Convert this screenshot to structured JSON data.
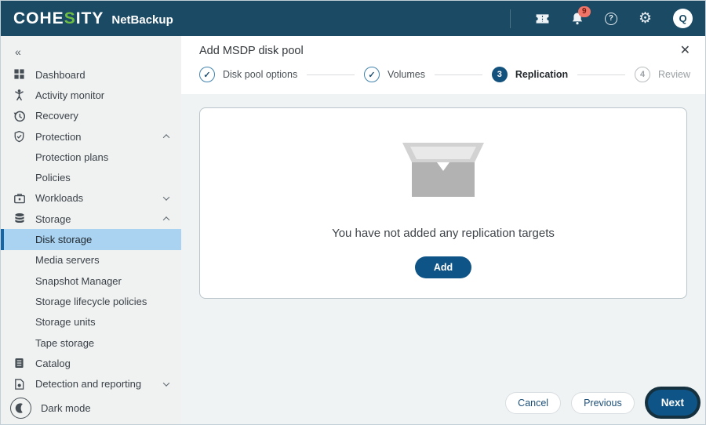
{
  "header": {
    "brand": {
      "part1": "COHE",
      "s": "S",
      "part2": "ITY",
      "product": "NetBackup"
    },
    "icons": [
      "ticket-icon",
      "bell-icon",
      "help-icon",
      "gear-icon",
      "avatar"
    ],
    "notification_count": "9",
    "help_glyph": "?",
    "avatar_initial": "Q"
  },
  "sidebar": {
    "collapse_glyph": "«",
    "items": [
      {
        "icon": "dashboard-icon",
        "label": "Dashboard"
      },
      {
        "icon": "activity-monitor-icon",
        "label": "Activity monitor"
      },
      {
        "icon": "recovery-icon",
        "label": "Recovery"
      },
      {
        "icon": "protection-shield-icon",
        "label": "Protection",
        "chevron": "up"
      },
      {
        "label": "Protection plans",
        "indent": true
      },
      {
        "label": "Policies",
        "indent": true
      },
      {
        "icon": "workloads-icon",
        "label": "Workloads",
        "chevron": "down"
      },
      {
        "icon": "storage-icon",
        "label": "Storage",
        "chevron": "up"
      },
      {
        "label": "Disk storage",
        "indent": true,
        "selected": true
      },
      {
        "label": "Media servers",
        "indent": true
      },
      {
        "label": "Snapshot Manager",
        "indent": true
      },
      {
        "label": "Storage lifecycle policies",
        "indent": true
      },
      {
        "label": "Storage units",
        "indent": true
      },
      {
        "label": "Tape storage",
        "indent": true
      },
      {
        "icon": "catalog-icon",
        "label": "Catalog"
      },
      {
        "icon": "detection-reporting-icon",
        "label": "Detection and reporting",
        "chevron": "down"
      }
    ],
    "dark_mode_label": "Dark mode"
  },
  "wizard": {
    "title": "Add MSDP disk pool",
    "close_glyph": "✕",
    "check_glyph": "✓",
    "steps": [
      {
        "label": "Disk pool options",
        "state": "done"
      },
      {
        "label": "Volumes",
        "state": "done"
      },
      {
        "label": "Replication",
        "state": "active",
        "number": "3"
      },
      {
        "label": "Review",
        "state": "pending",
        "number": "4"
      }
    ],
    "empty_state": {
      "icon": "empty-box-icon",
      "message": "You have not added any replication targets",
      "add_label": "Add"
    },
    "footer": {
      "cancel": "Cancel",
      "previous": "Previous",
      "next": "Next"
    }
  },
  "colors": {
    "header_bg": "#1b4a64",
    "brand_green": "#6fbe44",
    "badge_red": "#ef7568",
    "sidebar_bg": "#f0f1f1",
    "selected_bg": "#a9d3f1",
    "selected_border": "#1566a8",
    "accent_blue": "#0f5486",
    "pane_bg": "#f0f3f4"
  }
}
